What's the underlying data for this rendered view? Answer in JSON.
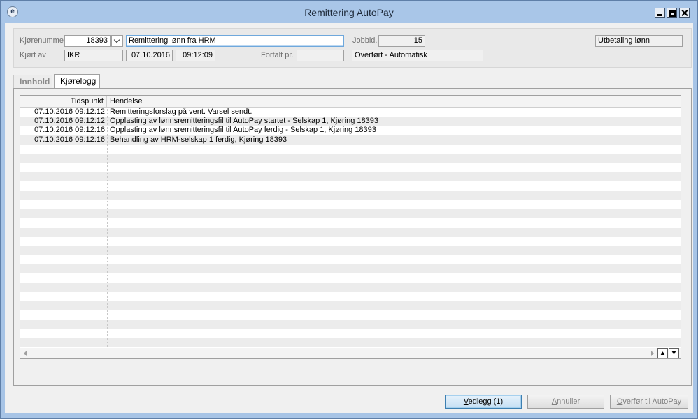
{
  "window": {
    "title": "Remittering AutoPay"
  },
  "header": {
    "run_number_label": "Kjørenummer",
    "run_number": "18393",
    "description": "Remittering lønn fra HRM",
    "job_id_label": "Jobbid.",
    "job_id": "15",
    "type": "Utbetaling lønn",
    "run_by_label": "Kjørt av",
    "run_by": "IKR",
    "run_date": "07.10.2016",
    "run_time": "09:12:09",
    "due_label": "Forfalt pr.",
    "due_value": "",
    "status": "Overført - Automatisk"
  },
  "tabs": [
    {
      "label": "Innhold",
      "active": false
    },
    {
      "label": "Kjørelogg",
      "active": true
    }
  ],
  "log": {
    "columns": [
      "Tidspunkt",
      "Hendelse"
    ],
    "rows": [
      {
        "time": "07.10.2016 09:12:12",
        "event": "Remitteringsforslag på vent. Varsel sendt."
      },
      {
        "time": "07.10.2016 09:12:12",
        "event": "Opplasting av lønnsremitteringsfil til AutoPay startet - Selskap 1, Kjøring 18393"
      },
      {
        "time": "07.10.2016 09:12:16",
        "event": "Opplasting av lønnsremitteringsfil til AutoPay ferdig - Selskap 1, Kjøring 18393"
      },
      {
        "time": "07.10.2016 09:12:16",
        "event": "Behandling av HRM-selskap 1 ferdig, Kjøring 18393"
      }
    ]
  },
  "buttons": {
    "attachments_u": "V",
    "attachments_rest": "edlegg (1)",
    "cancel_u": "A",
    "cancel_rest": "nnuller",
    "transfer_u": "O",
    "transfer_rest": "verfør til AutoPay"
  }
}
